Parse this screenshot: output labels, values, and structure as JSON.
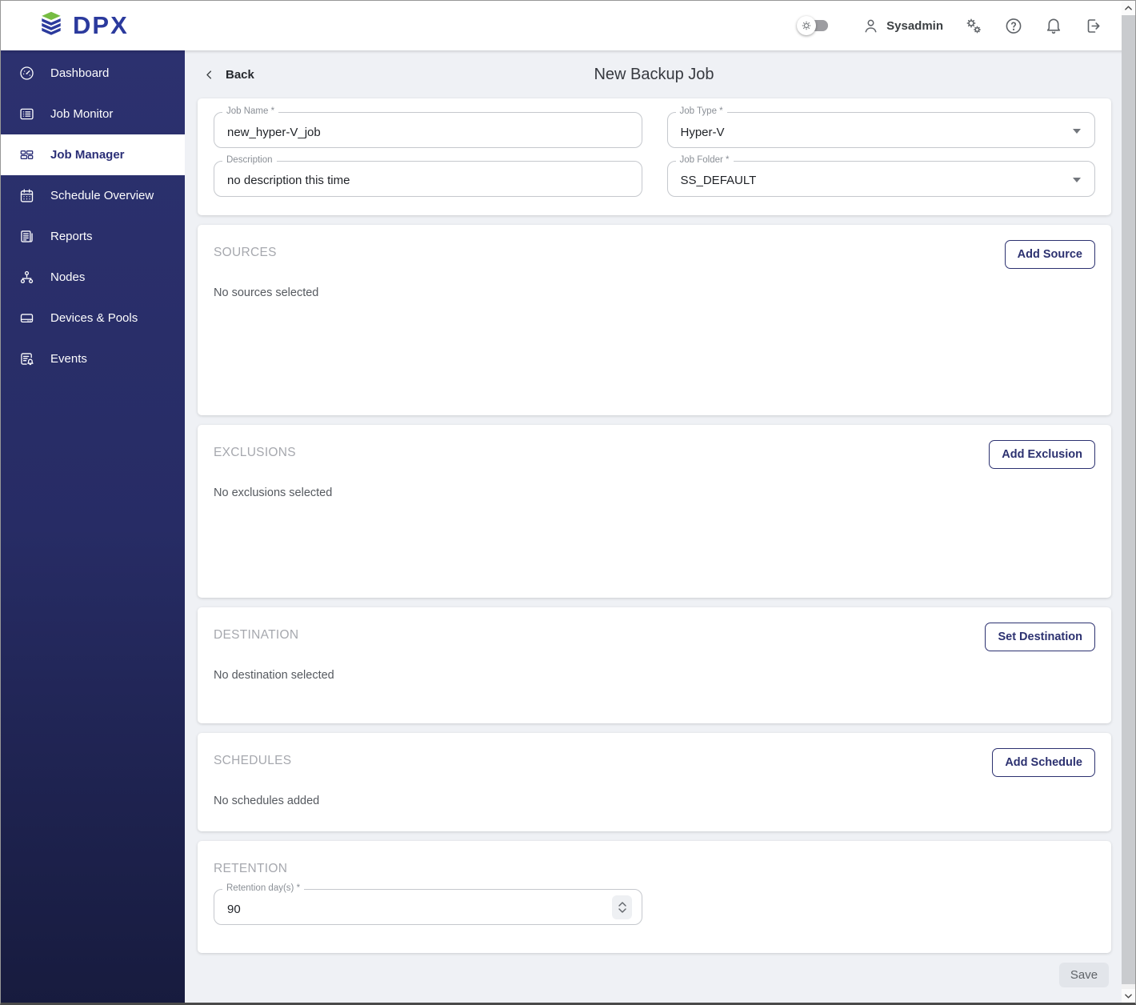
{
  "header": {
    "brand": "DPX",
    "user_name": "Sysadmin",
    "icons": [
      "settings-toggle",
      "user",
      "manage-settings",
      "help",
      "notifications",
      "logout"
    ]
  },
  "sidebar": {
    "items": [
      {
        "label": "Dashboard",
        "icon": "dashboard-icon",
        "active": false
      },
      {
        "label": "Job Monitor",
        "icon": "job-monitor-icon",
        "active": false
      },
      {
        "label": "Job Manager",
        "icon": "job-manager-icon",
        "active": true
      },
      {
        "label": "Schedule Overview",
        "icon": "schedule-overview-icon",
        "active": false
      },
      {
        "label": "Reports",
        "icon": "reports-icon",
        "active": false
      },
      {
        "label": "Nodes",
        "icon": "nodes-icon",
        "active": false
      },
      {
        "label": "Devices & Pools",
        "icon": "devices-pools-icon",
        "active": false
      },
      {
        "label": "Events",
        "icon": "events-icon",
        "active": false
      }
    ]
  },
  "page": {
    "back_label": "Back",
    "title": "New Backup Job"
  },
  "form": {
    "job_name": {
      "label": "Job Name *",
      "value": "new_hyper-V_job"
    },
    "description": {
      "label": "Description",
      "value": "no description this time"
    },
    "job_type": {
      "label": "Job Type *",
      "value": "Hyper-V"
    },
    "job_folder": {
      "label": "Job Folder *",
      "value": "SS_DEFAULT"
    }
  },
  "sections": {
    "sources": {
      "title": "SOURCES",
      "button_label": "Add Source",
      "empty_text": "No sources selected"
    },
    "exclusions": {
      "title": "EXCLUSIONS",
      "button_label": "Add Exclusion",
      "empty_text": "No exclusions selected"
    },
    "destination": {
      "title": "DESTINATION",
      "button_label": "Set Destination",
      "empty_text": "No destination selected"
    },
    "schedules": {
      "title": "SCHEDULES",
      "button_label": "Add Schedule",
      "empty_text": "No schedules added"
    }
  },
  "retention": {
    "title": "RETENTION",
    "field_label": "Retention day(s) *",
    "value": "90"
  },
  "footer": {
    "save_label": "Save"
  },
  "colors": {
    "brand_blue": "#2b3a9d",
    "brand_green": "#76bc43",
    "sidebar_navy_top": "#2c316f",
    "sidebar_navy_bottom": "#171b3e",
    "accent_navy": "#2c3170",
    "page_bg": "#eff1f5"
  }
}
